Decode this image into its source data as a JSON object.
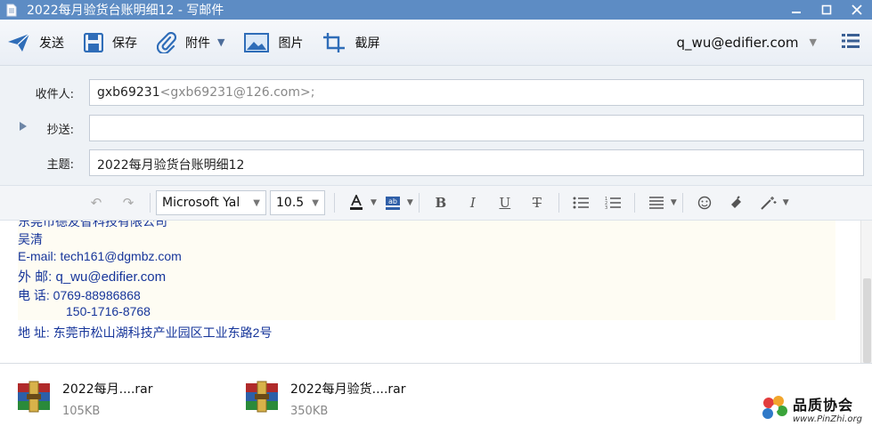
{
  "window": {
    "title": "2022每月验货台账明细12 - 写邮件"
  },
  "toolbar": {
    "send_label": "发送",
    "save_label": "保存",
    "attach_label": "附件",
    "image_label": "图片",
    "screenshot_label": "截屏",
    "account": "q_wu@edifier.com"
  },
  "fields": {
    "to_label": "收件人:",
    "to_name": "gxb69231",
    "to_email": "<gxb69231@126.com>;",
    "cc_label": "抄送:",
    "cc_value": "",
    "subject_label": "主题:",
    "subject_value": "2022每月验货台账明细12"
  },
  "format": {
    "font_family": "Microsoft Yal",
    "font_size": "10.5",
    "text_color": "#222222",
    "highlight_color": "#2f5fa8"
  },
  "signature": {
    "company_partial": "东莞市德友智科技有限公司",
    "name": "吴清",
    "email_line": "E-mail: tech161@dgmbz.com",
    "external_line": "外  邮: q_wu@edifier.com",
    "phone_line": "电  话: 0769-88986868",
    "mobile_line": "150-1716-8768",
    "address_line": "地  址: 东莞市松山湖科技产业园区工业东路2号"
  },
  "attachments": [
    {
      "name": "2022每月....rar",
      "size": "105KB"
    },
    {
      "name": "2022每月验货....rar",
      "size": "350KB"
    }
  ],
  "watermark": {
    "title": "品质协会",
    "url": "www.PinZhi.org"
  }
}
